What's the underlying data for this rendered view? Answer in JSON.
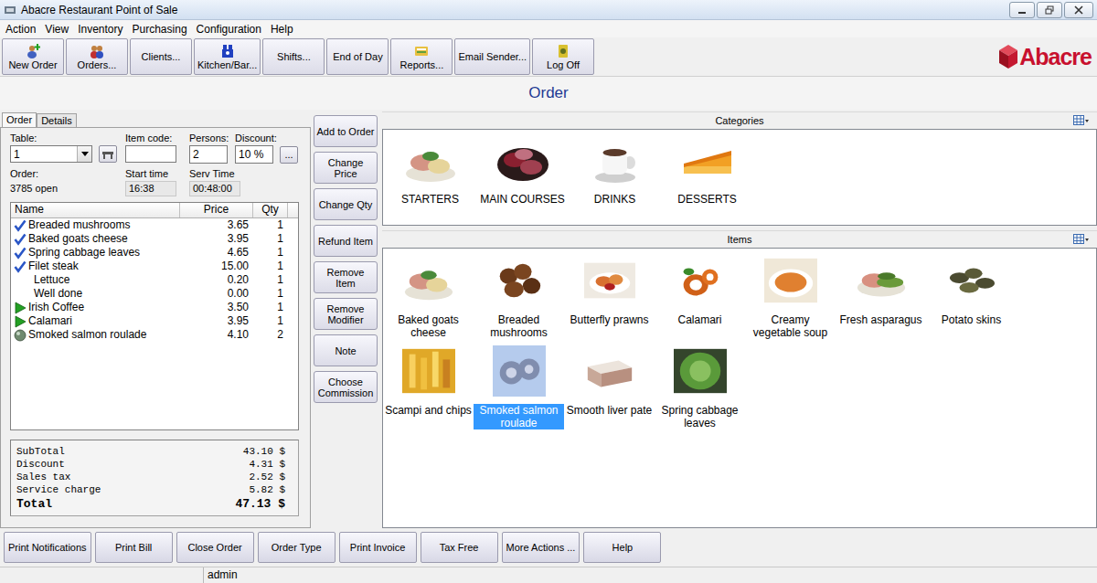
{
  "window": {
    "title": "Abacre Restaurant Point of Sale"
  },
  "menu": [
    "Action",
    "View",
    "Inventory",
    "Purchasing",
    "Configuration",
    "Help"
  ],
  "toolbar": [
    {
      "label": "New Order",
      "kind": "icon"
    },
    {
      "label": "Orders...",
      "kind": "icon"
    },
    {
      "label": "Clients...",
      "kind": "plain"
    },
    {
      "label": "Kitchen/Bar...",
      "kind": "icon"
    },
    {
      "label": "Shifts...",
      "kind": "plain"
    },
    {
      "label": "End of Day",
      "kind": "plain"
    },
    {
      "label": "Reports...",
      "kind": "icon"
    },
    {
      "label": "Email Sender...",
      "kind": "plain"
    },
    {
      "label": "Log Off",
      "kind": "icon"
    }
  ],
  "logo": "Abacre",
  "page_title": "Order",
  "order_tabs": [
    {
      "label": "Order",
      "selected": true
    },
    {
      "label": "Details",
      "selected": false
    }
  ],
  "fields": {
    "table": {
      "label": "Table:",
      "value": "1"
    },
    "item_code": {
      "label": "Item code:",
      "value": ""
    },
    "persons": {
      "label": "Persons:",
      "value": "2"
    },
    "discount": {
      "label": "Discount:",
      "value": "10 %"
    },
    "more_button": "...",
    "order": {
      "label": "Order:",
      "value": "3785 open"
    },
    "start_time": {
      "label": "Start time",
      "value": "16:38"
    },
    "serv_time": {
      "label": "Serv Time",
      "value": "00:48:00"
    }
  },
  "table": {
    "columns": [
      "Name",
      "Price",
      "Qty"
    ],
    "rows": [
      {
        "name": "Breaded mushrooms",
        "price": "3.65",
        "qty": "1",
        "kind": "sent"
      },
      {
        "name": "Baked goats cheese",
        "price": "3.95",
        "qty": "1",
        "kind": "sent"
      },
      {
        "name": "Spring cabbage leaves",
        "price": "4.65",
        "qty": "1",
        "kind": "sent"
      },
      {
        "name": "Filet steak",
        "price": "15.00",
        "qty": "1",
        "kind": "sent"
      },
      {
        "name": "Lettuce",
        "price": "0.20",
        "qty": "1",
        "kind": "modifier"
      },
      {
        "name": "Well done",
        "price": "0.00",
        "qty": "1",
        "kind": "modifier"
      },
      {
        "name": "Irish Coffee",
        "price": "3.50",
        "qty": "1",
        "kind": "new"
      },
      {
        "name": "Calamari",
        "price": "3.95",
        "qty": "1",
        "kind": "new"
      },
      {
        "name": "Smoked salmon roulade",
        "price": "4.10",
        "qty": "2",
        "kind": "held"
      }
    ]
  },
  "totals": [
    {
      "label": "SubTotal",
      "value": "43.10 $",
      "bold": false
    },
    {
      "label": "Discount",
      "value": "4.31 $",
      "bold": false
    },
    {
      "label": "Sales tax",
      "value": "2.52 $",
      "bold": false
    },
    {
      "label": "Service charge",
      "value": "5.82 $",
      "bold": false
    },
    {
      "label": "Total",
      "value": "47.13 $",
      "bold": true
    }
  ],
  "actions": [
    "Add to Order",
    "Change Price",
    "Change Qty",
    "Refund Item",
    "Remove Item",
    "Remove Modifier",
    "Note",
    "Choose Commission"
  ],
  "categories": {
    "title": "Categories",
    "items": [
      {
        "label": "STARTERS"
      },
      {
        "label": "MAIN COURSES"
      },
      {
        "label": "DRINKS"
      },
      {
        "label": "DESSERTS"
      }
    ]
  },
  "items": {
    "title": "Items",
    "items": [
      {
        "label": "Baked goats cheese",
        "selected": false
      },
      {
        "label": "Breaded mushrooms",
        "selected": false
      },
      {
        "label": "Butterfly prawns",
        "selected": false
      },
      {
        "label": "Calamari",
        "selected": false
      },
      {
        "label": "Creamy vegetable soup",
        "selected": false
      },
      {
        "label": "Fresh asparagus",
        "selected": false
      },
      {
        "label": "Potato skins",
        "selected": false
      },
      {
        "label": "Scampi and chips",
        "selected": false
      },
      {
        "label": "Smoked salmon roulade",
        "selected": true
      },
      {
        "label": "Smooth liver pate",
        "selected": false
      },
      {
        "label": "Spring cabbage leaves",
        "selected": false
      }
    ]
  },
  "bottom_buttons": [
    "Print Notifications",
    "Print Bill",
    "Close Order",
    "Order Type",
    "Print Invoice",
    "Tax Free",
    "More Actions ...",
    "Help"
  ],
  "status_bar": [
    "",
    "admin"
  ]
}
